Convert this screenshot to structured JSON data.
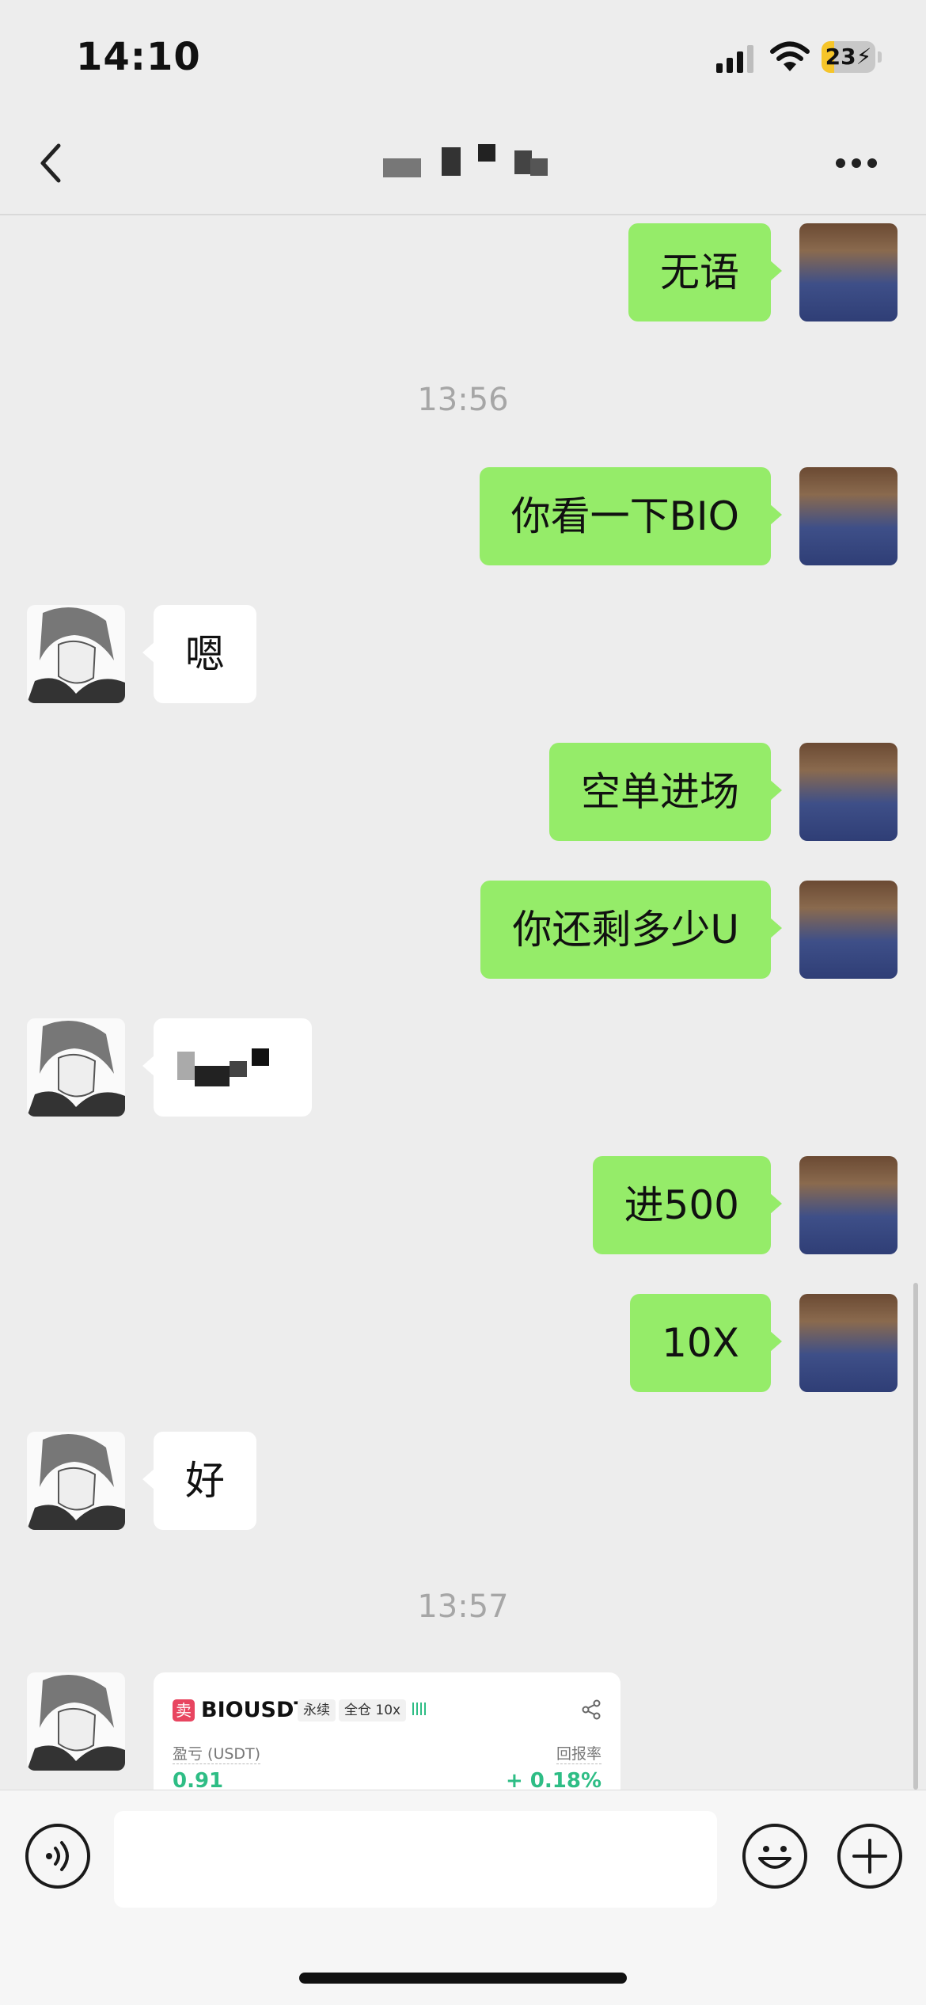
{
  "status_bar": {
    "time": "14:10",
    "battery_level": "23",
    "battery_fraction": 0.23,
    "battery_charging": true
  },
  "nav": {
    "back_icon": "chevron-left-icon",
    "title": "",
    "title_redacted": true,
    "more_icon": "ellipsis-icon"
  },
  "colors": {
    "background": "#ededed",
    "my_bubble": "#95ec69",
    "peer_bubble": "#ffffff",
    "positive": "#2ebd85",
    "sell_badge": "#e84560"
  },
  "messages": [
    {
      "sender": "me",
      "text": "无语"
    },
    {
      "type": "timestamp",
      "text": "13:56"
    },
    {
      "sender": "me",
      "text": "你看一下BIO"
    },
    {
      "sender": "peer",
      "text": "嗯"
    },
    {
      "sender": "me",
      "text": "空单进场"
    },
    {
      "sender": "me",
      "text": "你还剩多少U"
    },
    {
      "sender": "peer",
      "text": "",
      "redacted": true
    },
    {
      "sender": "me",
      "text": "进500"
    },
    {
      "sender": "me",
      "text": "10X"
    },
    {
      "sender": "peer",
      "text": "好"
    },
    {
      "type": "timestamp",
      "text": "13:57"
    },
    {
      "sender": "peer",
      "type": "trade_card"
    }
  ],
  "trade_card": {
    "side_badge": "卖",
    "symbol": "BIOUSDT",
    "contract_type": "永续",
    "margin_mode": "全仓 10x",
    "pnl_label": "盈亏 (USDT)",
    "roi_label": "回报率",
    "pnl_value": "0.91",
    "roi_value": "+ 0.18%",
    "share_icon": "share-icon"
  },
  "input_bar": {
    "voice_icon": "voice-icon",
    "emoji_icon": "emoji-icon",
    "plus_icon": "plus-icon",
    "text_value": ""
  }
}
